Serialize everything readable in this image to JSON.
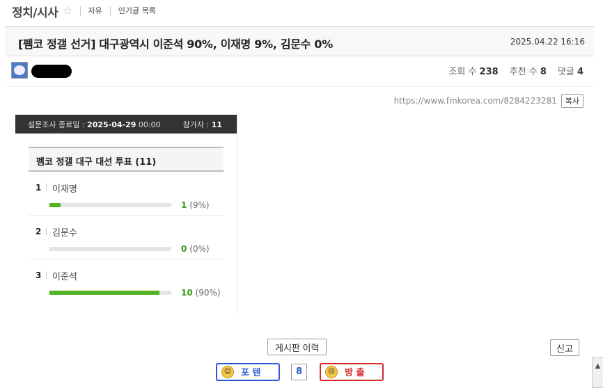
{
  "board": {
    "title": "정치/시사",
    "star_icon": "star-icon",
    "links": [
      "자유",
      "인기글 목록"
    ]
  },
  "post": {
    "title": "[펨코 정갤 선거] 대구광역시 이준석 90%, 이재명 9%, 김문수 0%",
    "date": "2025.04.22 16:16",
    "stats": {
      "views_label": "조회 수",
      "views": "238",
      "recommend_label": "추천 수",
      "recommend": "8",
      "comments_label": "댓글",
      "comments": "4"
    },
    "url": "https://www.fmkorea.com/8284223281",
    "copy_label": "복사"
  },
  "poll": {
    "end_label": "설문조사 종료일 :",
    "end_date": "2025-04-29",
    "end_time": "00:00",
    "participants_label": "참가자 :",
    "participants": "11",
    "question": "펨코 정갤 대구 대선 투표 (11)",
    "options": [
      {
        "num": "1",
        "label": "이재명",
        "count": "1",
        "pct": "(9%)",
        "fraction": 0.09
      },
      {
        "num": "2",
        "label": "김문수",
        "count": "0",
        "pct": "(0%)",
        "fraction": 0.0
      },
      {
        "num": "3",
        "label": "이준석",
        "count": "10",
        "pct": "(90%)",
        "fraction": 0.9
      }
    ],
    "bar_color": "#53b523"
  },
  "actions": {
    "history_label": "게시판 이력",
    "report_label": "신고",
    "upvote_label": "포 텐",
    "vote_count": "8",
    "downvote_label": "방 출"
  }
}
